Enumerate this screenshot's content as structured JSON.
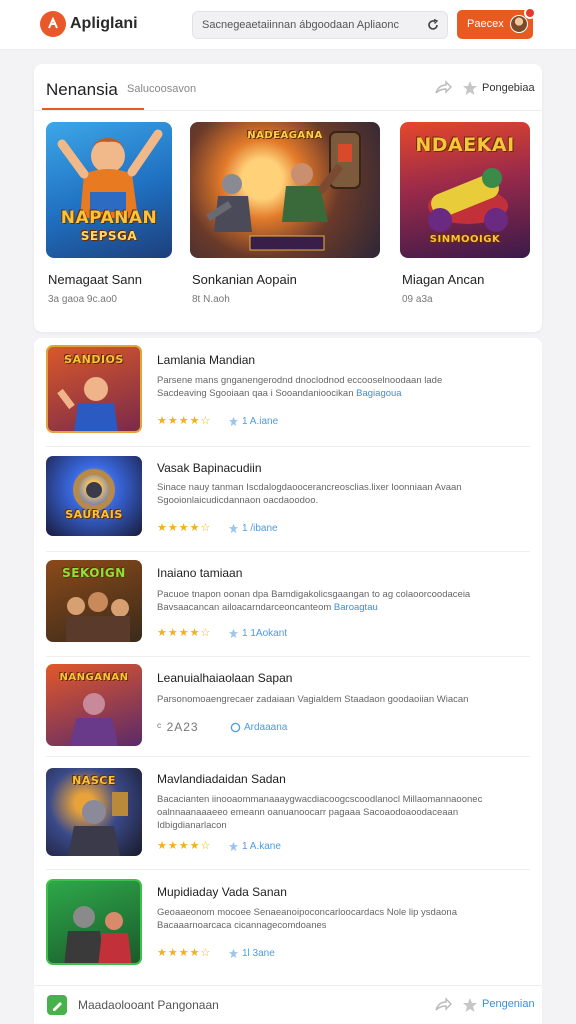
{
  "header": {
    "app_name": "Apliglani",
    "search_text": "Sacnegeaetaiinnan ábgoodaan Apliaonc",
    "cta_label": "Paecex"
  },
  "featured": {
    "tab_active": "Nenansia",
    "tab_inactive": "Salucoosavon",
    "top_right_label": "Pongebiaa",
    "items": [
      {
        "title": "Nemagaat Sann",
        "meta": "3a gaoa 9c.ao0",
        "art_line1": "NAPANAN",
        "art_line2": "SEPSGA"
      },
      {
        "title": "Sonkanian Aopain",
        "meta": "8t N.aoh",
        "art_line1": "NADEAGANA",
        "art_line2": ""
      },
      {
        "title": "Miagan Ancan",
        "meta": "09 a3a",
        "art_line1": "NDAEKAI",
        "art_line2": "SINMOOIGK"
      }
    ]
  },
  "list": {
    "items": [
      {
        "title": "Lamlania Mandian",
        "desc": "Parsene mans gnganengerodnd dnoclodnod eccooselnoodaan lade Sacdeaving Sgooiaan qaa i Sooandanioocikan",
        "link": "Bagiagoua",
        "rating": "★★★★☆",
        "count": "1 A.iane",
        "art": "SANDIOS"
      },
      {
        "title": "Vasak Bapinacudiin",
        "desc": "Sinace nauy tanman Iscdalogdaoocerancreosclias.lixer loonniaan Avaan Sgooionlaicudicdannaon oacdaoodoo.",
        "link": "",
        "rating": "★★★★☆",
        "count": "1 /ibane",
        "art": "SAURAIS"
      },
      {
        "title": "Inaiano tamiaan",
        "desc": "Pacuoe tnapon oonan dpa Bamdigakolicsgaangan to ag colaoorcoodaceia Bavsaacancan ailoacarndarceoncanteom",
        "link": "Baroagtau",
        "rating": "★★★★☆",
        "count": "1 1Aokant",
        "art": "SEKOIGN"
      },
      {
        "title": "Leanuialhaiaolaan Sapan",
        "desc": "Parsonomoaengrecaer zadaiaan Vagialdem Staadaon goodaoiian Wiacan",
        "link": "",
        "rating": "ᶜ 2A23",
        "count": "Ardaaana",
        "art": "NANGANAN"
      },
      {
        "title": "Mavlandiadaidan Sadan",
        "desc": "Bacacianten iinooaommanaaaygwacdiacoogcscoodlanocl Millaomannaoonec oalnnaanaaaeeo emeann oanuanoocarr pagaaa Sacoaodoaoodaceaan Idbigdianarlacon",
        "link": "",
        "rating": "★★★★☆",
        "count": "1 A.kane",
        "art": "NASCE"
      },
      {
        "title": "Mupidiaday Vada Sanan",
        "desc": "Geoaaeonom mocoee Senaeanoipoconcarloocardacs Nole lip ysdaona Bacaaarnoarcaca cicannagecomdoanes",
        "link": "",
        "rating": "★★★★☆",
        "count": "1l 3ane",
        "art": ""
      }
    ]
  },
  "bottom": {
    "label": "Maadaolooant Pangonaan",
    "right_label": "Pengenian"
  },
  "colors": {
    "accent": "#e85a1f",
    "link": "#3a8fd6",
    "star": "#f1b11b"
  }
}
